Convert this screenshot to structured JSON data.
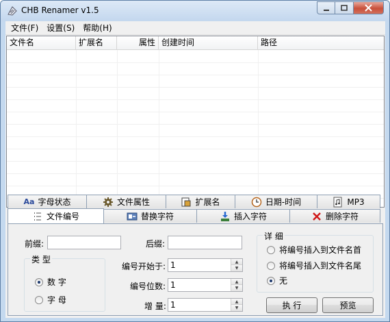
{
  "window": {
    "title": "CHB Renamer v1.5"
  },
  "menu": [
    "文件(F)",
    "设置(S)",
    "帮助(H)"
  ],
  "list": {
    "columns": [
      "文件名",
      "扩展名",
      "属性",
      "创建时间",
      "路径"
    ]
  },
  "tabs_top": [
    {
      "label": "字母状态",
      "icon": "Aa"
    },
    {
      "label": "文件属性",
      "icon": "gear-icon"
    },
    {
      "label": "扩展名",
      "icon": "extension-icon"
    },
    {
      "label": "日期-时间",
      "icon": "clock-icon"
    },
    {
      "label": "MP3",
      "icon": "mp3-icon"
    }
  ],
  "tabs_bottom": [
    {
      "label": "文件编号",
      "icon": "numbered-list-icon",
      "active": true
    },
    {
      "label": "替换字符",
      "icon": "replace-icon"
    },
    {
      "label": "插入字符",
      "icon": "insert-icon"
    },
    {
      "label": "删除字符",
      "icon": "delete-icon"
    }
  ],
  "form": {
    "prefix_label": "前缀:",
    "suffix_label": "后缀:",
    "type_group": "类 型",
    "type_number": "数 字",
    "type_letter": "字 母",
    "start_label": "编号开始于:",
    "start_value": "1",
    "digits_label": "编号位数:",
    "digits_value": "1",
    "increment_label": "增 量:",
    "increment_value": "1",
    "detail_group": "详 细",
    "detail_front": "将编号插入到文件名首",
    "detail_end": "将编号插入到文件名尾",
    "detail_none": "无",
    "run_button": "执 行",
    "preview_button": "预览"
  }
}
